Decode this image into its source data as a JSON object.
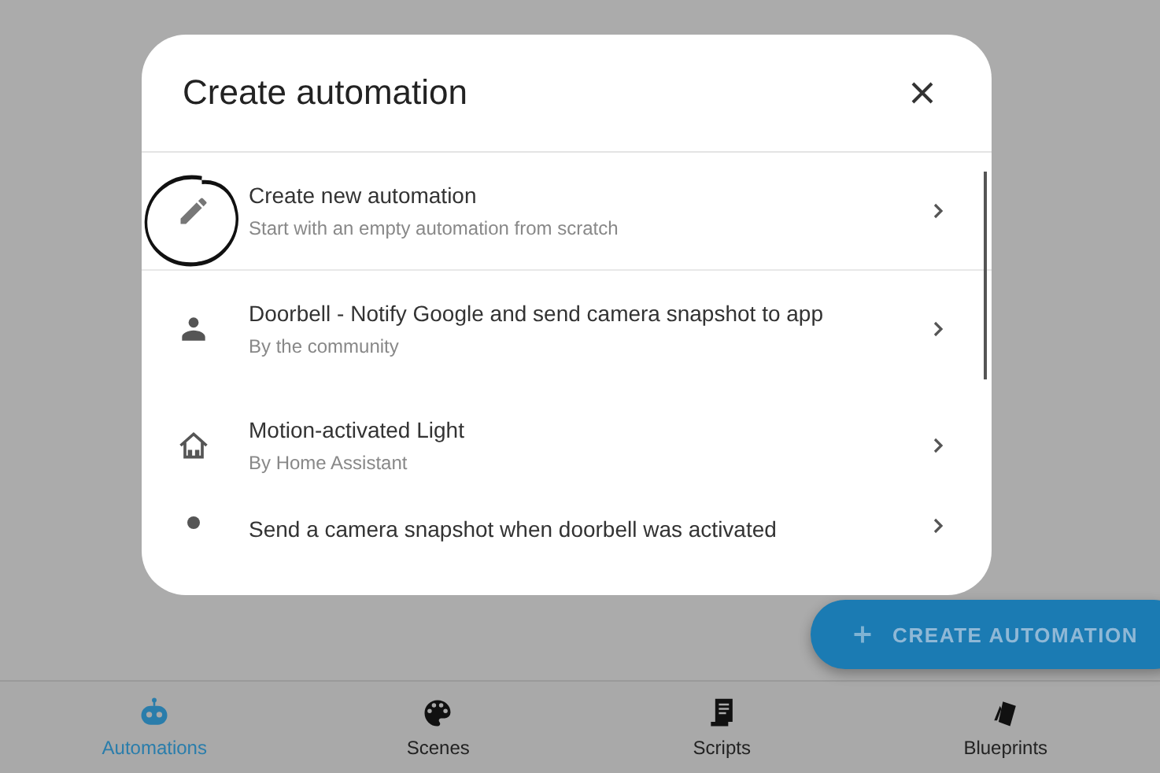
{
  "fab": {
    "label": "CREATE AUTOMATION"
  },
  "dialog": {
    "title": "Create automation",
    "items": [
      {
        "kind": "pencil",
        "title": "Create new automation",
        "subtitle": "Start with an empty automation from scratch"
      },
      {
        "kind": "person",
        "title": "Doorbell - Notify Google and send camera snapshot to app",
        "subtitle": "By the community"
      },
      {
        "kind": "house",
        "title": "Motion-activated Light",
        "subtitle": "By Home Assistant"
      },
      {
        "kind": "dot",
        "title": "Send a camera snapshot when doorbell was activated"
      }
    ]
  },
  "bottom_nav": [
    {
      "kind": "robot",
      "label": "Automations",
      "selected": true
    },
    {
      "kind": "palette",
      "label": "Scenes",
      "selected": false
    },
    {
      "kind": "script",
      "label": "Scripts",
      "selected": false
    },
    {
      "kind": "blueprint",
      "label": "Blueprints",
      "selected": false
    }
  ]
}
